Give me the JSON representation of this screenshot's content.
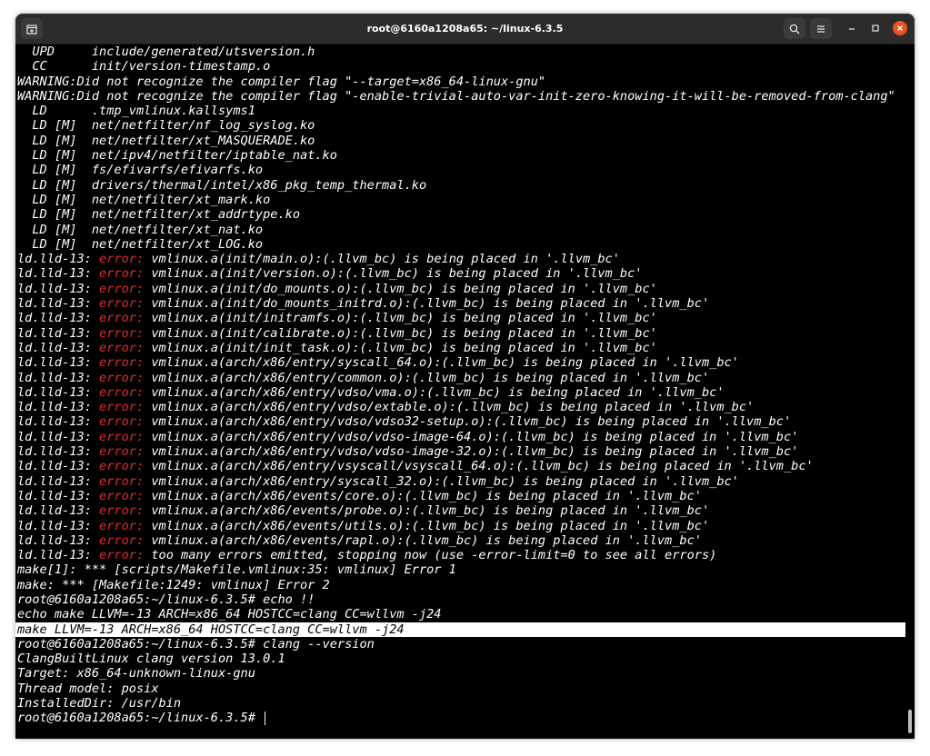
{
  "window": {
    "title": "root@6160a1208a65: ~/linux-6.3.5",
    "close_color": "#e95420",
    "titlebar_color": "#2c2c2c"
  },
  "icons": {
    "new_tab": "new-tab-icon",
    "search": "search-icon",
    "menu": "hamburger-menu-icon",
    "minimize": "minimize-icon",
    "maximize": "maximize-icon",
    "close": "close-icon"
  },
  "terminal": {
    "error_color": "#e32a2a",
    "lines": [
      {
        "text": "  UPD     include/generated/utsversion.h"
      },
      {
        "text": "  CC      init/version-timestamp.o"
      },
      {
        "text": "WARNING:Did not recognize the compiler flag \"--target=x86_64-linux-gnu\""
      },
      {
        "text": "WARNING:Did not recognize the compiler flag \"-enable-trivial-auto-var-init-zero-knowing-it-will-be-removed-from-clang\""
      },
      {
        "text": "  LD      .tmp_vmlinux.kallsyms1"
      },
      {
        "text": "  LD [M]  net/netfilter/nf_log_syslog.ko"
      },
      {
        "text": "  LD [M]  net/netfilter/xt_MASQUERADE.ko"
      },
      {
        "text": "  LD [M]  net/ipv4/netfilter/iptable_nat.ko"
      },
      {
        "text": "  LD [M]  fs/efivarfs/efivarfs.ko"
      },
      {
        "text": "  LD [M]  drivers/thermal/intel/x86_pkg_temp_thermal.ko"
      },
      {
        "text": "  LD [M]  net/netfilter/xt_mark.ko"
      },
      {
        "text": "  LD [M]  net/netfilter/xt_addrtype.ko"
      },
      {
        "text": "  LD [M]  net/netfilter/xt_nat.ko"
      },
      {
        "text": "  LD [M]  net/netfilter/xt_LOG.ko"
      },
      {
        "prefix": "ld.lld-13: ",
        "error": "error:",
        "text": " vmlinux.a(init/main.o):(.llvm_bc) is being placed in '.llvm_bc'"
      },
      {
        "prefix": "ld.lld-13: ",
        "error": "error:",
        "text": " vmlinux.a(init/version.o):(.llvm_bc) is being placed in '.llvm_bc'"
      },
      {
        "prefix": "ld.lld-13: ",
        "error": "error:",
        "text": " vmlinux.a(init/do_mounts.o):(.llvm_bc) is being placed in '.llvm_bc'"
      },
      {
        "prefix": "ld.lld-13: ",
        "error": "error:",
        "text": " vmlinux.a(init/do_mounts_initrd.o):(.llvm_bc) is being placed in '.llvm_bc'"
      },
      {
        "prefix": "ld.lld-13: ",
        "error": "error:",
        "text": " vmlinux.a(init/initramfs.o):(.llvm_bc) is being placed in '.llvm_bc'"
      },
      {
        "prefix": "ld.lld-13: ",
        "error": "error:",
        "text": " vmlinux.a(init/calibrate.o):(.llvm_bc) is being placed in '.llvm_bc'"
      },
      {
        "prefix": "ld.lld-13: ",
        "error": "error:",
        "text": " vmlinux.a(init/init_task.o):(.llvm_bc) is being placed in '.llvm_bc'"
      },
      {
        "prefix": "ld.lld-13: ",
        "error": "error:",
        "text": " vmlinux.a(arch/x86/entry/syscall_64.o):(.llvm_bc) is being placed in '.llvm_bc'"
      },
      {
        "prefix": "ld.lld-13: ",
        "error": "error:",
        "text": " vmlinux.a(arch/x86/entry/common.o):(.llvm_bc) is being placed in '.llvm_bc'"
      },
      {
        "prefix": "ld.lld-13: ",
        "error": "error:",
        "text": " vmlinux.a(arch/x86/entry/vdso/vma.o):(.llvm_bc) is being placed in '.llvm_bc'"
      },
      {
        "prefix": "ld.lld-13: ",
        "error": "error:",
        "text": " vmlinux.a(arch/x86/entry/vdso/extable.o):(.llvm_bc) is being placed in '.llvm_bc'"
      },
      {
        "prefix": "ld.lld-13: ",
        "error": "error:",
        "text": " vmlinux.a(arch/x86/entry/vdso/vdso32-setup.o):(.llvm_bc) is being placed in '.llvm_bc'"
      },
      {
        "prefix": "ld.lld-13: ",
        "error": "error:",
        "text": " vmlinux.a(arch/x86/entry/vdso/vdso-image-64.o):(.llvm_bc) is being placed in '.llvm_bc'"
      },
      {
        "prefix": "ld.lld-13: ",
        "error": "error:",
        "text": " vmlinux.a(arch/x86/entry/vdso/vdso-image-32.o):(.llvm_bc) is being placed in '.llvm_bc'"
      },
      {
        "prefix": "ld.lld-13: ",
        "error": "error:",
        "text": " vmlinux.a(arch/x86/entry/vsyscall/vsyscall_64.o):(.llvm_bc) is being placed in '.llvm_bc'"
      },
      {
        "prefix": "ld.lld-13: ",
        "error": "error:",
        "text": " vmlinux.a(arch/x86/entry/syscall_32.o):(.llvm_bc) is being placed in '.llvm_bc'"
      },
      {
        "prefix": "ld.lld-13: ",
        "error": "error:",
        "text": " vmlinux.a(arch/x86/events/core.o):(.llvm_bc) is being placed in '.llvm_bc'"
      },
      {
        "prefix": "ld.lld-13: ",
        "error": "error:",
        "text": " vmlinux.a(arch/x86/events/probe.o):(.llvm_bc) is being placed in '.llvm_bc'"
      },
      {
        "prefix": "ld.lld-13: ",
        "error": "error:",
        "text": " vmlinux.a(arch/x86/events/utils.o):(.llvm_bc) is being placed in '.llvm_bc'"
      },
      {
        "prefix": "ld.lld-13: ",
        "error": "error:",
        "text": " vmlinux.a(arch/x86/events/rapl.o):(.llvm_bc) is being placed in '.llvm_bc'"
      },
      {
        "prefix": "ld.lld-13: ",
        "error": "error:",
        "text": " too many errors emitted, stopping now (use -error-limit=0 to see all errors)"
      },
      {
        "text": "make[1]: *** [scripts/Makefile.vmlinux:35: vmlinux] Error 1"
      },
      {
        "text": "make: *** [Makefile:1249: vmlinux] Error 2"
      },
      {
        "text": "root@6160a1208a65:~/linux-6.3.5# echo !!"
      },
      {
        "text": "echo make LLVM=-13 ARCH=x86_64 HOSTCC=clang CC=wllvm -j24"
      },
      {
        "text": "make LLVM=-13 ARCH=x86_64 HOSTCC=clang CC=wllvm -j24",
        "selected": true
      },
      {
        "text": "root@6160a1208a65:~/linux-6.3.5# clang --version"
      },
      {
        "text": "ClangBuiltLinux clang version 13.0.1"
      },
      {
        "text": "Target: x86_64-unknown-linux-gnu"
      },
      {
        "text": "Thread model: posix"
      },
      {
        "text": "InstalledDir: /usr/bin"
      },
      {
        "text": "root@6160a1208a65:~/linux-6.3.5# ",
        "cursor": true
      }
    ]
  }
}
